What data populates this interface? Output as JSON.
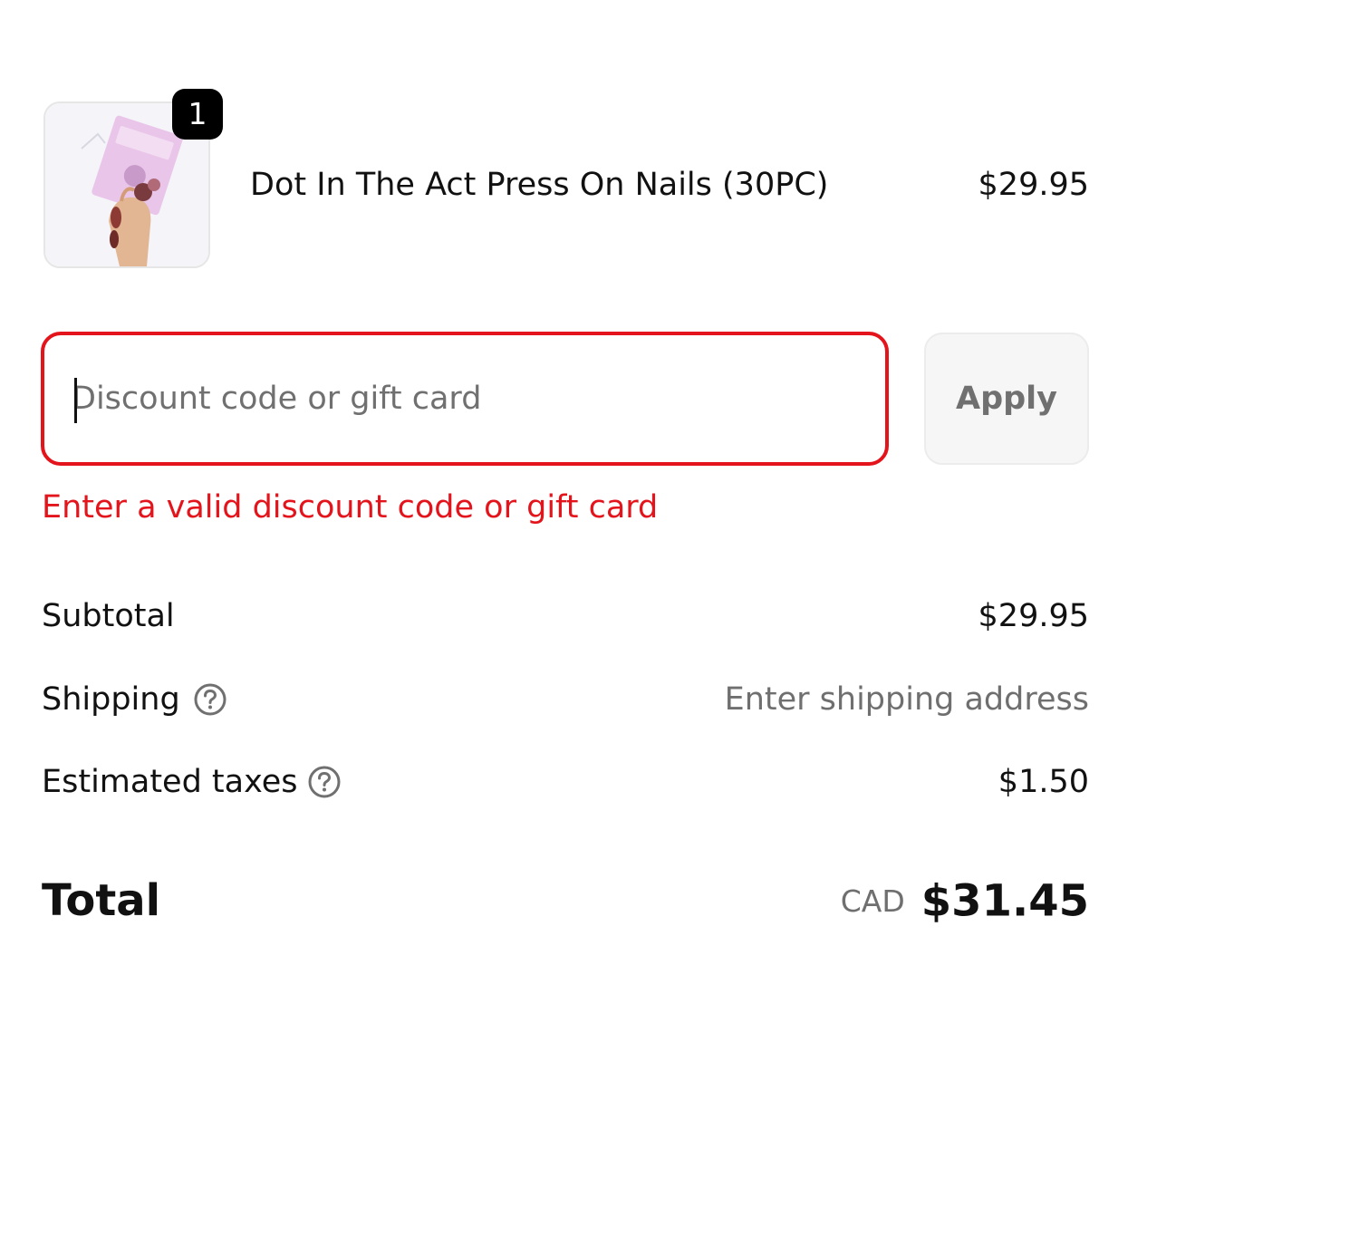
{
  "line_item": {
    "quantity": "1",
    "name": "Dot In The Act Press On Nails (30PC)",
    "price": "$29.95",
    "image": "press-on-nails-product-photo"
  },
  "discount": {
    "placeholder": "Discount code or gift card",
    "value": "",
    "apply_label": "Apply",
    "error": "Enter a valid discount code or gift card",
    "error_color": "#e3141b"
  },
  "summary": {
    "subtotal_label": "Subtotal",
    "subtotal_value": "$29.95",
    "shipping_label": "Shipping",
    "shipping_value": "Enter shipping address",
    "taxes_label": "Estimated taxes",
    "taxes_value": "$1.50",
    "help_icon": "question-circle-icon"
  },
  "total": {
    "label": "Total",
    "currency": "CAD",
    "amount": "$31.45"
  }
}
